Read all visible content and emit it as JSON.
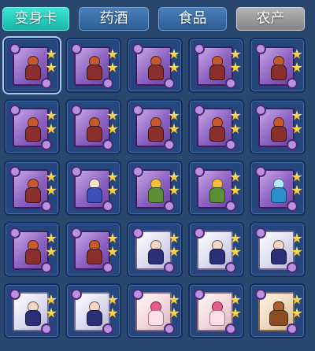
{
  "tabs": [
    {
      "label": "变身卡",
      "state": "active"
    },
    {
      "label": "药酒",
      "state": "normal"
    },
    {
      "label": "食品",
      "state": "normal"
    },
    {
      "label": "农产",
      "state": "disabled"
    }
  ],
  "colors": {
    "background": "#29466f",
    "tab_active": "#2fd3c1",
    "tab_normal": "#3d6fa8",
    "tab_disabled": "#9a9a9a",
    "star": "#f6c21a"
  },
  "grid": {
    "columns": 5,
    "rows": 5,
    "items": [
      {
        "card_style": "purple",
        "figure": "red-warrior",
        "stars": 2
      },
      {
        "card_style": "purple",
        "figure": "red-warrior",
        "stars": 2
      },
      {
        "card_style": "purple",
        "figure": "red-warrior",
        "stars": 2
      },
      {
        "card_style": "purple",
        "figure": "red-warrior",
        "stars": 2
      },
      {
        "card_style": "purple",
        "figure": "red-warrior",
        "stars": 2
      },
      {
        "card_style": "purple",
        "figure": "red-warrior",
        "stars": 2
      },
      {
        "card_style": "purple",
        "figure": "red-warrior",
        "stars": 2
      },
      {
        "card_style": "purple",
        "figure": "red-warrior",
        "stars": 2
      },
      {
        "card_style": "purple",
        "figure": "red-warrior",
        "stars": 2
      },
      {
        "card_style": "purple",
        "figure": "red-warrior",
        "stars": 2
      },
      {
        "card_style": "purple",
        "figure": "red-warrior",
        "stars": 2
      },
      {
        "card_style": "purple",
        "figure": "mage",
        "stars": 2
      },
      {
        "card_style": "purple",
        "figure": "gold-warrior",
        "stars": 2
      },
      {
        "card_style": "purple",
        "figure": "gold-warrior",
        "stars": 2
      },
      {
        "card_style": "purple",
        "figure": "cyan-spirit",
        "stars": 2
      },
      {
        "card_style": "purple",
        "figure": "red-warrior",
        "stars": 2
      },
      {
        "card_style": "purple",
        "figure": "red-warrior",
        "stars": 2
      },
      {
        "card_style": "white",
        "figure": "navy-ninja",
        "stars": 2
      },
      {
        "card_style": "white",
        "figure": "navy-ninja",
        "stars": 2
      },
      {
        "card_style": "white",
        "figure": "navy-ninja",
        "stars": 2
      },
      {
        "card_style": "white",
        "figure": "navy-ninja",
        "stars": 2
      },
      {
        "card_style": "white",
        "figure": "navy-ninja",
        "stars": 2
      },
      {
        "card_style": "pink",
        "figure": "pink-girl",
        "stars": 2
      },
      {
        "card_style": "pink",
        "figure": "pink-girl",
        "stars": 2
      },
      {
        "card_style": "beige",
        "figure": "bear",
        "stars": 2
      }
    ]
  }
}
